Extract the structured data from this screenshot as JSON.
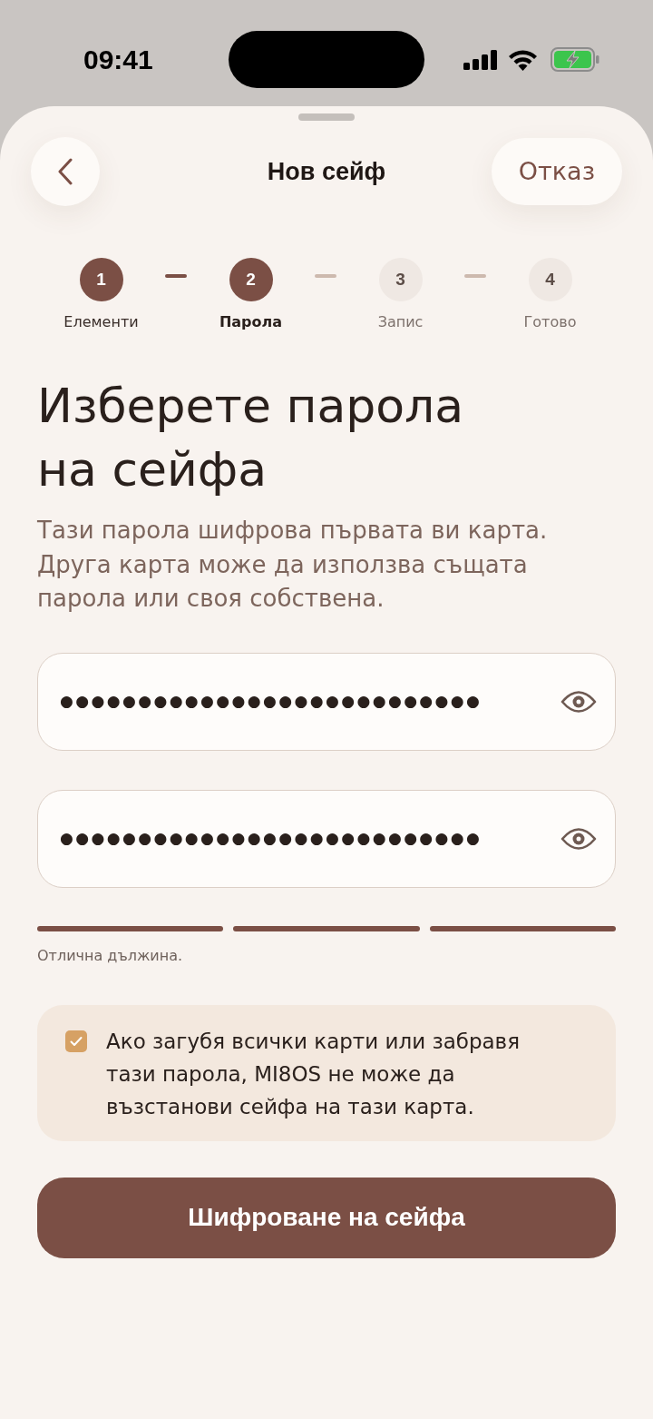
{
  "status_bar": {
    "time": "09:41"
  },
  "header": {
    "title": "Нов сейф",
    "cancel": "Отказ"
  },
  "steps": [
    {
      "number": "1",
      "label": "Елементи",
      "completed": true,
      "selected": false
    },
    {
      "number": "2",
      "label": "Парола",
      "completed": false,
      "selected": true
    },
    {
      "number": "3",
      "label": "Запис",
      "completed": false,
      "selected": false
    },
    {
      "number": "4",
      "label": "Готово",
      "completed": false,
      "selected": false
    }
  ],
  "heading": "Изберете парола на сейфа",
  "description": "Тази парола шифрова първата ви карта. Друга карта може да използва същата парола или своя собствена.",
  "fields": [
    {
      "value": "●●●●●●●●●●●●●●●●●●●●●●●●●●●"
    },
    {
      "value": "●●●●●●●●●●●●●●●●●●●●●●●●●●●"
    }
  ],
  "strength": {
    "segments": [
      {
        "on": true
      },
      {
        "on": true
      },
      {
        "on": true
      }
    ],
    "caption": "Отлична дължина."
  },
  "acknowledgement": {
    "checked": true,
    "text": "Ако загубя всички карти или забравя тази парола, MI8OS не може да възстанови сейфа на тази карта."
  },
  "submit": "Шифроване на сейфа"
}
